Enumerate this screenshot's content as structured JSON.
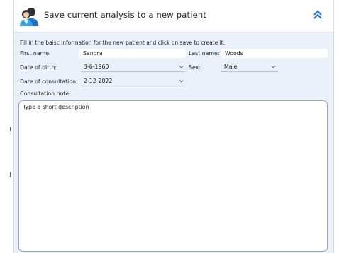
{
  "header": {
    "title": "Save current analysis to a new patient",
    "icon": "patient-group-icon",
    "collapse_icon": "double-chevron-up-icon",
    "accent": "#2e7ad6"
  },
  "form": {
    "intro": "Fill in the baisc information for the new patient and click on save to create it:",
    "first_name": {
      "label": "First name:",
      "value": "Sandra"
    },
    "last_name": {
      "label": "Last name:",
      "value": "Woods"
    },
    "date_of_birth": {
      "label": "Date of birth:",
      "value": "3-6-1960"
    },
    "sex": {
      "label": "Sex:",
      "value": "Male"
    },
    "date_of_consultation": {
      "label": "Date of consultation:",
      "value": "2-12-2022"
    },
    "consultation_note": {
      "label": "Consultation note:",
      "placeholder": "Type a short description"
    }
  }
}
